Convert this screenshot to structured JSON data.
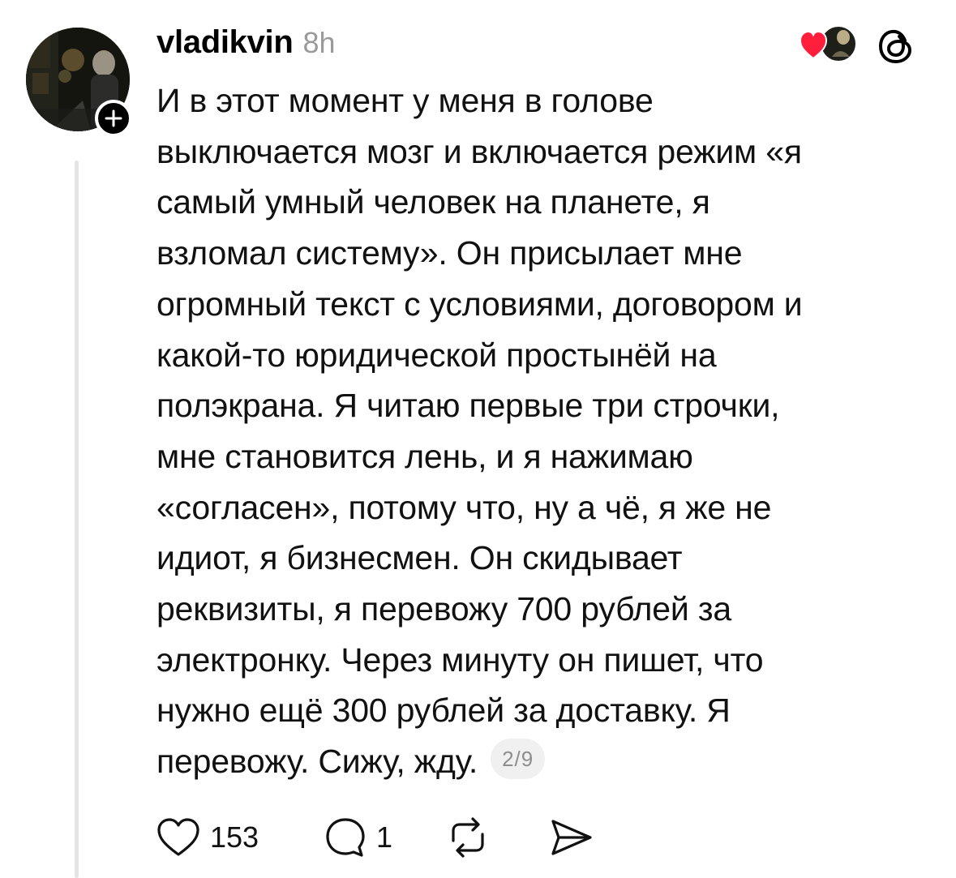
{
  "post": {
    "author": "vladikvin",
    "timestamp": "8h",
    "text": "И в этот момент у меня в голове\nвыключается мозг и включается режим «я\nсамый умный человек на планете, я\nвзломал систему». Он присылает мне\nогромный текст с условиями, договором и\nкакой-то юридической простынёй на\nполэкрана. Я читаю первые три строчки,\nмне становится лень, и я нажимаю\n«согласен», потому что, ну а чё, я же не\nидиот, я бизнесмен. Он скидывает\nреквизиты, я перевожу 700 рублей за\nэлектронку. Через минуту он пишет, что\nнужно ещё 300 рублей за доставку. Я\nперевожу. Сижу, жду.",
    "page_indicator": "2/9"
  },
  "icons": {
    "avatar": "profile-photo",
    "follow": "plus-icon",
    "liked_by": "heart-with-avatar-icon",
    "logo": "threads-logo-icon",
    "like": "heart-outline-icon",
    "reply": "comment-bubble-icon",
    "repost": "repost-arrows-icon",
    "share": "send-icon"
  },
  "actions": {
    "like_count": "153",
    "reply_count": "1"
  },
  "colors": {
    "heart": "#ff1f3d",
    "muted_text": "#9a9a9a",
    "thread_line": "#e4e4e4"
  }
}
